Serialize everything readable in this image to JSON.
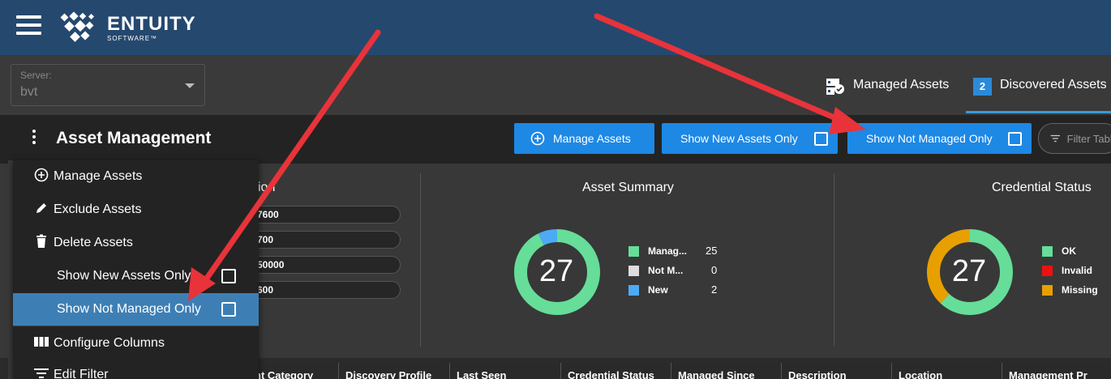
{
  "app": {
    "brand": "ENTUITY",
    "brand_sub": "SOFTWARE™"
  },
  "server": {
    "label": "Server:",
    "value": "bvt"
  },
  "tabs": [
    {
      "label": "Managed Assets",
      "icon": "managed-assets-icon"
    },
    {
      "label": "Discovered Assets",
      "badge": "2"
    }
  ],
  "toolbar": {
    "title": "Asset Management",
    "manage_label": "Manage Assets",
    "new_only_label": "Show New Assets Only",
    "not_managed_label": "Show Not Managed Only",
    "filter_placeholder": "Filter Table"
  },
  "menu": {
    "items": [
      {
        "label": "Manage Assets",
        "icon": "plus-circle-icon"
      },
      {
        "label": "Exclude Assets",
        "icon": "pencil-icon"
      },
      {
        "label": "Delete Assets",
        "icon": "trash-icon"
      },
      {
        "label": "Show New Assets Only",
        "checked": false
      },
      {
        "label": "Show Not Managed Only",
        "checked": false
      },
      {
        "label": "Configure Columns",
        "icon": "columns-icon"
      },
      {
        "label": "Edit Filter",
        "icon": "filter-icon"
      }
    ]
  },
  "panel1": {
    "title_partial": "ion",
    "pills": [
      "7600",
      "700",
      "50000",
      "600"
    ]
  },
  "asset_summary": {
    "title": "Asset Summary",
    "total": "27",
    "legend": [
      {
        "label": "Manag...",
        "value": "25",
        "color": "#66dd99",
        "count": 25
      },
      {
        "label": "Not M...",
        "value": "0",
        "color": "#dddddd",
        "count": 0
      },
      {
        "label": "New",
        "value": "2",
        "color": "#4dabf5",
        "count": 2
      }
    ]
  },
  "credential_status": {
    "title": "Credential Status",
    "total": "27",
    "legend": [
      {
        "label": "OK",
        "color": "#66dd99",
        "share": 0.62
      },
      {
        "label": "Invalid",
        "color": "#ee1111",
        "share": 0.0
      },
      {
        "label": "Missing",
        "color": "#e8a000",
        "share": 0.38
      }
    ]
  },
  "table": {
    "columns": [
      "nt Category",
      "Discovery Profile",
      "Last Seen",
      "Credential Status",
      "Managed Since",
      "Description",
      "Location",
      "Management Pr"
    ]
  }
}
